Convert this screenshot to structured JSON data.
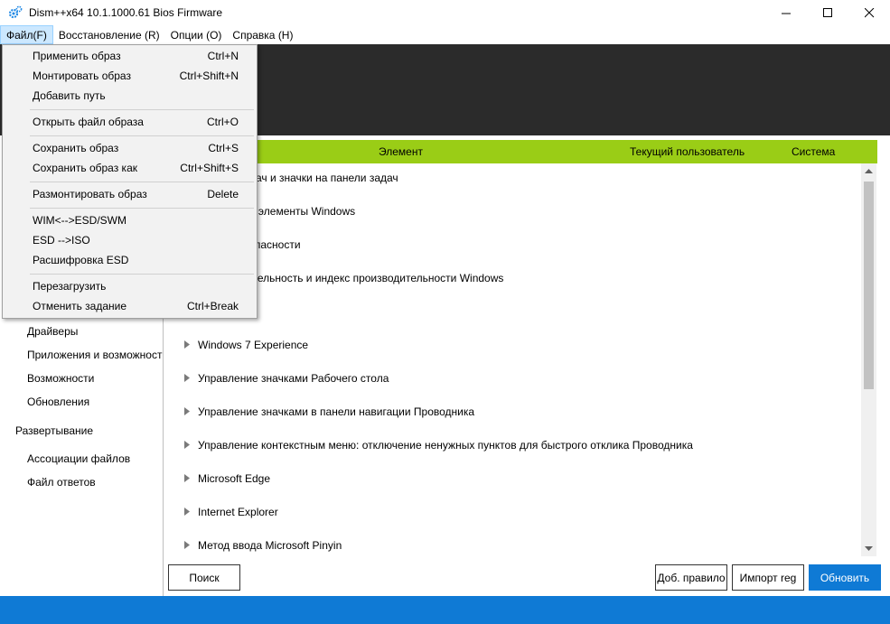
{
  "window": {
    "title": "Dism++x64 10.1.1000.61 Bios Firmware",
    "icon": "gear-icon",
    "controls": [
      "minimize-icon",
      "maximize-icon",
      "close-icon"
    ]
  },
  "menubar": {
    "items": [
      {
        "label": "Файл(F)",
        "active": true
      },
      {
        "label": "Восстановление (R)"
      },
      {
        "label": "Опции (O)"
      },
      {
        "label": "Справка (H)"
      }
    ]
  },
  "file_menu": {
    "groups": [
      [
        {
          "label": "Применить образ",
          "shortcut": "Ctrl+N"
        },
        {
          "label": "Монтировать образ",
          "shortcut": "Ctrl+Shift+N"
        },
        {
          "label": "Добавить путь",
          "shortcut": ""
        }
      ],
      [
        {
          "label": "Открыть файл образа",
          "shortcut": "Ctrl+O"
        }
      ],
      [
        {
          "label": "Сохранить образ",
          "shortcut": "Ctrl+S"
        },
        {
          "label": "Сохранить образ как",
          "shortcut": "Ctrl+Shift+S"
        }
      ],
      [
        {
          "label": "Размонтировать образ",
          "shortcut": "Delete"
        }
      ],
      [
        {
          "label": "WIM<-->ESD/SWM",
          "shortcut": ""
        },
        {
          "label": "ESD -->ISO",
          "shortcut": ""
        },
        {
          "label": "Расшифровка ESD",
          "shortcut": ""
        }
      ],
      [
        {
          "label": "Перезагрузить",
          "shortcut": ""
        },
        {
          "label": "Отменить задание",
          "shortcut": "Ctrl+Break"
        }
      ]
    ]
  },
  "sidebar": {
    "items": [
      {
        "label": "Драйверы",
        "type": "sub"
      },
      {
        "label": "Приложения и возможности",
        "type": "sub"
      },
      {
        "label": "Возможности",
        "type": "sub"
      },
      {
        "label": "Обновления",
        "type": "sub"
      },
      {
        "label": "Развертывание",
        "type": "group"
      },
      {
        "label": "Ассоциации файлов",
        "type": "sub"
      },
      {
        "label": "Файл ответов",
        "type": "sub"
      }
    ]
  },
  "table": {
    "headers": [
      "Элемент",
      "Текущий пользователь",
      "Система"
    ],
    "header_color": "#9acd16",
    "rows": [
      "Панель задач и значки на панели задач",
      "Системные элементы Windows",
      "Центр безопасности",
      "Производительность и индекс производительности Windows",
      "",
      "Windows 7 Experience",
      "Управление значками Рабочего стола",
      "Управление значками в панели навигации Проводника",
      "Управление контекстным меню: отключение ненужных пунктов для быстрого отклика Проводника",
      "Microsoft Edge",
      "Internet Explorer",
      "Метод ввода Microsoft Pinyin"
    ]
  },
  "buttons": {
    "search": "Поиск",
    "add_rule": "Доб. правило",
    "import_reg": "Импорт reg",
    "refresh": "Обновить"
  },
  "colors": {
    "accent": "#0f7ad5",
    "header_band": "#2b2b2b"
  }
}
